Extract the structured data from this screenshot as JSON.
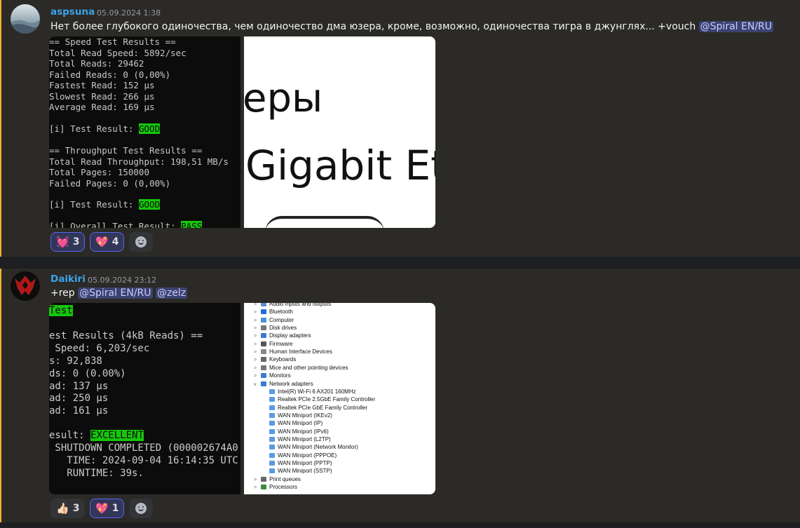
{
  "messages": [
    {
      "author": "aspsuna",
      "timestamp": "05.09.2024 1:38",
      "text": "Нет более глубокого одиночества, чем одиночество дма юзера, кроме, возможно, одиночества тигра в джунглях... +vouch ",
      "mention": "@Spiral EN/RU",
      "terminal_lines": [
        "== Speed Test Results ==",
        "Total Read Speed: 5892/sec",
        "Total Reads: 29462",
        "Failed Reads: 0 (0,00%)",
        "Fastest Read: 152 µs",
        "Slowest Read: 266 µs",
        "Average Read: 169 µs",
        "",
        "[i] Test Result: ",
        "",
        "== Throughput Test Results ==",
        "Total Read Throughput: 198,51 MB/s",
        "Total Pages: 150000",
        "Failed Pages: 0 (0,00%)",
        "",
        "[i] Test Result: ",
        "",
        "[i] Overall Test Result: "
      ],
      "terminal_good_1": "GOOD",
      "terminal_good_2": "GOOD",
      "terminal_pass": "PASS",
      "zoom_text_1": "еры",
      "zoom_text_2": "Gigabit Et",
      "reactions": [
        {
          "emoji": "💓",
          "count": "3"
        },
        {
          "emoji": "💖",
          "count": "4"
        }
      ]
    },
    {
      "author": "Daikiri",
      "timestamp": "05.09.2024 23:12",
      "text": "+rep ",
      "mentions": [
        "@Spiral EN/RU",
        "@zelz"
      ],
      "terminal_top_badge": "Test",
      "terminal_lines": [
        "est Results (4kB Reads) ==",
        " Speed: 6,203/sec",
        "s: 92,838",
        "ds: 0 (0.00%)",
        "ad: 137 µs",
        "ad: 250 µs",
        "ad: 161 µs",
        "",
        "esult: ",
        " SHUTDOWN COMPLETED (000002674A0",
        "   TIME: 2024-09-04 16:14:35 UTC",
        "   RUNTIME: 39s."
      ],
      "terminal_excellent": "EXCELLENT",
      "device_manager": [
        {
          "label": "Audio inputs and outputs",
          "expand": ">",
          "indent": 0,
          "color": "#5a8fd0"
        },
        {
          "label": "Bluetooth",
          "expand": ">",
          "indent": 0,
          "color": "#1e6fd9"
        },
        {
          "label": "Computer",
          "expand": ">",
          "indent": 0,
          "color": "#4a90d9"
        },
        {
          "label": "Disk drives",
          "expand": ">",
          "indent": 0,
          "color": "#777777"
        },
        {
          "label": "Display adapters",
          "expand": ">",
          "indent": 0,
          "color": "#3a7bd5"
        },
        {
          "label": "Firmware",
          "expand": ">",
          "indent": 0,
          "color": "#555555"
        },
        {
          "label": "Human Interface Devices",
          "expand": ">",
          "indent": 0,
          "color": "#888888"
        },
        {
          "label": "Keyboards",
          "expand": ">",
          "indent": 0,
          "color": "#666666"
        },
        {
          "label": "Mice and other pointing devices",
          "expand": ">",
          "indent": 0,
          "color": "#777777"
        },
        {
          "label": "Monitors",
          "expand": ">",
          "indent": 0,
          "color": "#3a7bd5"
        },
        {
          "label": "Network adapters",
          "expand": "v",
          "indent": 0,
          "color": "#3a7bd5"
        },
        {
          "label": "Intel(R) Wi-Fi 6 AX201 160MHz",
          "expand": "",
          "indent": 1,
          "color": "#5a9be0"
        },
        {
          "label": "Realtek PCIe 2.5GbE Family Controller",
          "expand": "",
          "indent": 1,
          "color": "#5a9be0"
        },
        {
          "label": "Realtek PCIe GbE Family Controller",
          "expand": "",
          "indent": 1,
          "color": "#5a9be0"
        },
        {
          "label": "WAN Miniport (IKEv2)",
          "expand": "",
          "indent": 1,
          "color": "#5a9be0"
        },
        {
          "label": "WAN Miniport (IP)",
          "expand": "",
          "indent": 1,
          "color": "#5a9be0"
        },
        {
          "label": "WAN Miniport (IPv6)",
          "expand": "",
          "indent": 1,
          "color": "#5a9be0"
        },
        {
          "label": "WAN Miniport (L2TP)",
          "expand": "",
          "indent": 1,
          "color": "#5a9be0"
        },
        {
          "label": "WAN Miniport (Network Monitor)",
          "expand": "",
          "indent": 1,
          "color": "#5a9be0"
        },
        {
          "label": "WAN Miniport (PPPOE)",
          "expand": "",
          "indent": 1,
          "color": "#5a9be0"
        },
        {
          "label": "WAN Miniport (PPTP)",
          "expand": "",
          "indent": 1,
          "color": "#5a9be0"
        },
        {
          "label": "WAN Miniport (SSTP)",
          "expand": "",
          "indent": 1,
          "color": "#5a9be0"
        },
        {
          "label": "Print queues",
          "expand": ">",
          "indent": 0,
          "color": "#666666"
        },
        {
          "label": "Processors",
          "expand": ">",
          "indent": 0,
          "color": "#3c8a3c"
        }
      ],
      "reactions": [
        {
          "emoji": "👍🏻",
          "count": "3"
        },
        {
          "emoji": "💖",
          "count": "1"
        }
      ]
    }
  ]
}
